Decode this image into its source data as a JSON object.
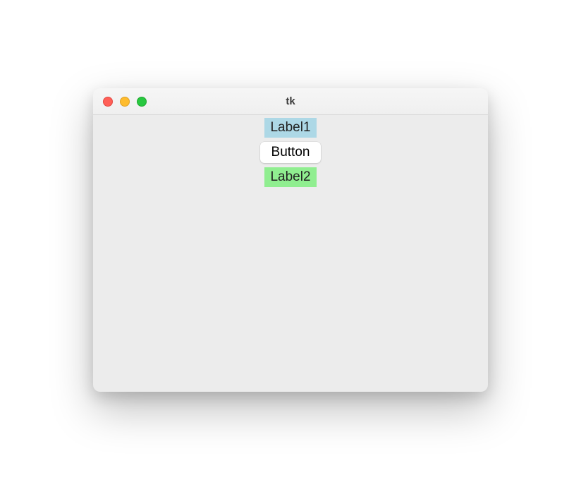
{
  "window": {
    "title": "tk"
  },
  "content": {
    "label1_text": "Label1",
    "button_text": "Button",
    "label2_text": "Label2"
  },
  "colors": {
    "label1_bg": "#add8e6",
    "label2_bg": "#90ee90",
    "window_bg": "#ececec"
  }
}
